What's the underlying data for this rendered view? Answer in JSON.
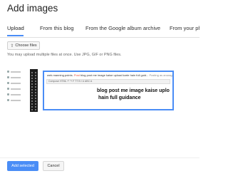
{
  "dialog": {
    "title": "Add images"
  },
  "tabs": [
    {
      "label": "Upload",
      "active": true
    },
    {
      "label": "From this blog"
    },
    {
      "label": "From the Google album archive"
    },
    {
      "label": "From your phone"
    }
  ],
  "upload": {
    "choose_files_label": "Choose files",
    "hint": "You may upload multiple files at once. Use JPG, GIF or PNG files."
  },
  "thumbnail": {
    "header_site": "web.manning.points.",
    "header_post": "Post",
    "header_title": "blog post me image kaise upload karte hain full guid...",
    "header_right": "Posting as anurag",
    "toolbar_text": "Compose   HTML   ↶  ↷   F   TT   B  I  U  ABC  A",
    "text_line1": "blog post me image kaise uplo",
    "text_line2": "hain full guidance"
  },
  "footer": {
    "add_selected_label": "Add selected",
    "cancel_label": "Cancel"
  },
  "colors": {
    "accent": "#4a8df6"
  }
}
